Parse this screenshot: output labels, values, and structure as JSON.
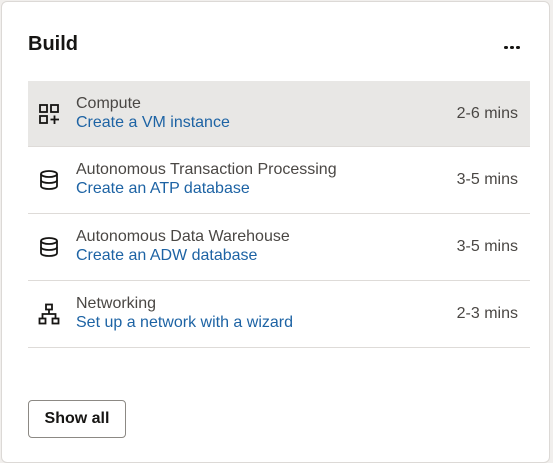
{
  "card": {
    "title": "Build",
    "more_actions_icon": "more-horizontal-icon"
  },
  "items": [
    {
      "icon": "grid-add-icon",
      "category": "Compute",
      "action": "Create a VM instance",
      "time": "2-6 mins",
      "highlighted": true
    },
    {
      "icon": "database-icon",
      "category": "Autonomous Transaction Processing",
      "action": "Create an ATP database",
      "time": "3-5 mins"
    },
    {
      "icon": "database-icon",
      "category": "Autonomous Data Warehouse",
      "action": "Create an ADW database",
      "time": "3-5 mins"
    },
    {
      "icon": "network-icon",
      "category": "Networking",
      "action": "Set up a network with a wizard",
      "time": "2-3 mins"
    }
  ],
  "footer": {
    "show_all_label": "Show all"
  },
  "colors": {
    "link": "#1d63a4",
    "hover_row": "#e8e7e5",
    "text_secondary": "#4a4744"
  }
}
